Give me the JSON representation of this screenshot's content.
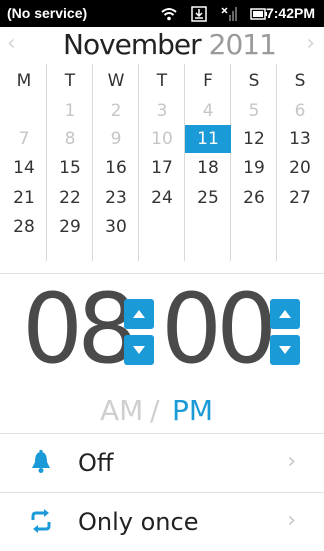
{
  "status_bar": {
    "carrier": "(No service)",
    "time": "7:42PM",
    "icons": [
      "wifi-icon",
      "download-icon",
      "no-signal-icon",
      "battery-icon"
    ]
  },
  "calendar": {
    "month": "November",
    "year": "2011",
    "prev_icon": "‹",
    "next_icon": "›",
    "weekdays": [
      "M",
      "T",
      "W",
      "T",
      "F",
      "S",
      "S"
    ],
    "weeks": [
      [
        {
          "d": "",
          "m": false
        },
        {
          "d": "1",
          "m": true
        },
        {
          "d": "2",
          "m": true
        },
        {
          "d": "3",
          "m": true
        },
        {
          "d": "4",
          "m": true
        },
        {
          "d": "5",
          "m": true
        },
        {
          "d": "6",
          "m": true
        }
      ],
      [
        {
          "d": "7",
          "m": true
        },
        {
          "d": "8",
          "m": true
        },
        {
          "d": "9",
          "m": true
        },
        {
          "d": "10",
          "m": true
        },
        {
          "d": "11",
          "m": false,
          "today": true
        },
        {
          "d": "12",
          "m": false
        },
        {
          "d": "13",
          "m": false
        }
      ],
      [
        {
          "d": "14",
          "m": false
        },
        {
          "d": "15",
          "m": false
        },
        {
          "d": "16",
          "m": false
        },
        {
          "d": "17",
          "m": false
        },
        {
          "d": "18",
          "m": false
        },
        {
          "d": "19",
          "m": false
        },
        {
          "d": "20",
          "m": false
        }
      ],
      [
        {
          "d": "21",
          "m": false
        },
        {
          "d": "22",
          "m": false
        },
        {
          "d": "23",
          "m": false
        },
        {
          "d": "24",
          "m": false
        },
        {
          "d": "25",
          "m": false
        },
        {
          "d": "26",
          "m": false
        },
        {
          "d": "27",
          "m": false
        }
      ],
      [
        {
          "d": "28",
          "m": false
        },
        {
          "d": "29",
          "m": false
        },
        {
          "d": "30",
          "m": false
        },
        {
          "d": "",
          "m": false
        },
        {
          "d": "",
          "m": false
        },
        {
          "d": "",
          "m": false
        },
        {
          "d": "",
          "m": false
        }
      ]
    ],
    "selected_day": "11"
  },
  "time_picker": {
    "hours": "08",
    "minutes": "00",
    "am_label": "AM",
    "separator": "/",
    "pm_label": "PM",
    "selected_period": "PM"
  },
  "options": [
    {
      "icon": "bell-icon",
      "label": "Off"
    },
    {
      "icon": "repeat-icon",
      "label": "Only once"
    }
  ],
  "colors": {
    "accent": "#1a9ad6",
    "muted": "#c6c6c6",
    "text": "#333333"
  }
}
